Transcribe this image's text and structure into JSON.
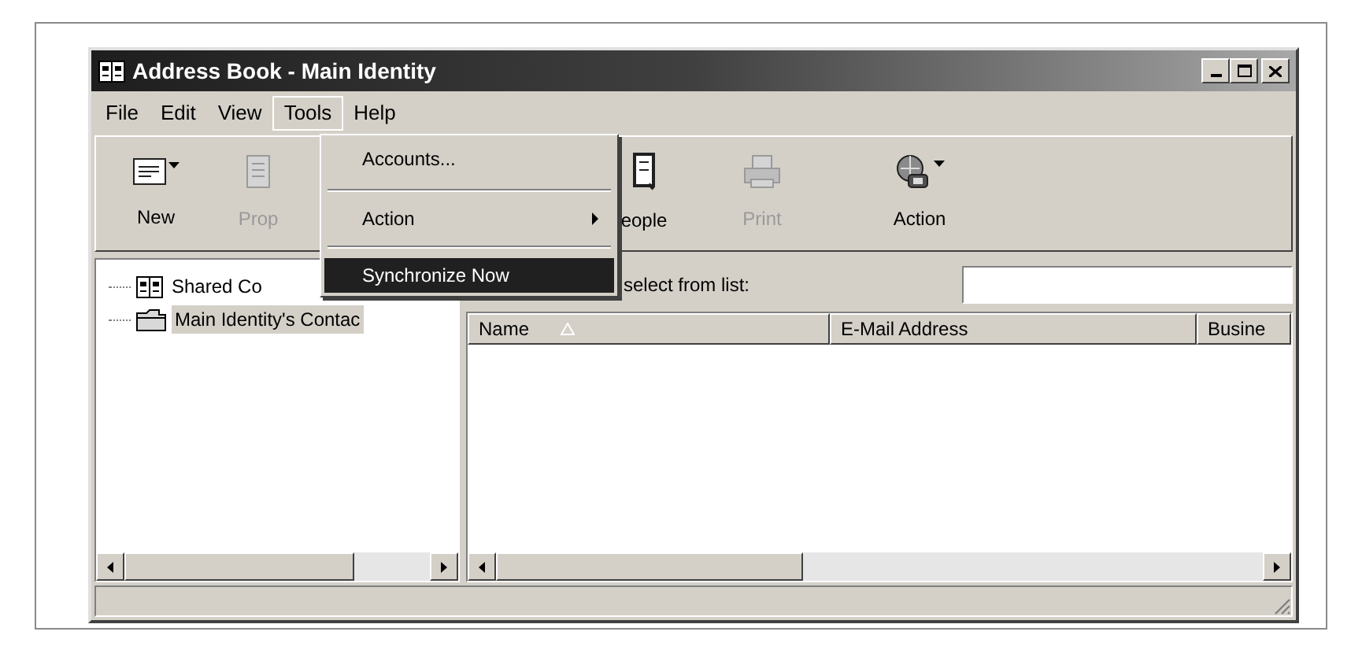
{
  "window": {
    "title": "Address Book - Main Identity"
  },
  "menu_bar": [
    {
      "label": "File",
      "selected": false
    },
    {
      "label": "Edit",
      "selected": false
    },
    {
      "label": "View",
      "selected": false
    },
    {
      "label": "Tools",
      "selected": true
    },
    {
      "label": "Help",
      "selected": false
    }
  ],
  "tools_menu": [
    {
      "kind": "item",
      "label": "Accounts...",
      "submenu": false,
      "selected": false
    },
    {
      "kind": "separator"
    },
    {
      "kind": "item",
      "label": "Action",
      "submenu": true,
      "selected": false
    },
    {
      "kind": "separator"
    },
    {
      "kind": "item",
      "label": "Synchronize Now",
      "submenu": false,
      "selected": true
    }
  ],
  "toolbar": [
    {
      "label": "New",
      "kind": "card",
      "dropdown": true,
      "disabled": false
    },
    {
      "label": "Prop",
      "kind": "properties",
      "dropdown": false,
      "disabled": true
    },
    {
      "label": "eople",
      "kind": "people",
      "dropdown": false,
      "disabled": false
    },
    {
      "label": "Print",
      "kind": "printer",
      "dropdown": false,
      "disabled": true
    },
    {
      "label": "Action",
      "kind": "globe-phone",
      "dropdown": true,
      "disabled": false
    }
  ],
  "tree": [
    {
      "label": "Shared Co",
      "kind": "book",
      "selected": false
    },
    {
      "label": "Main Identity's Contac",
      "kind": "folder",
      "selected": true
    }
  ],
  "search": {
    "label": "select from list:"
  },
  "table": {
    "columns": [
      {
        "label": "Name",
        "sorted": true
      },
      {
        "label": "E-Mail Address",
        "sorted": false
      },
      {
        "label": "Busine",
        "sorted": false
      }
    ]
  }
}
